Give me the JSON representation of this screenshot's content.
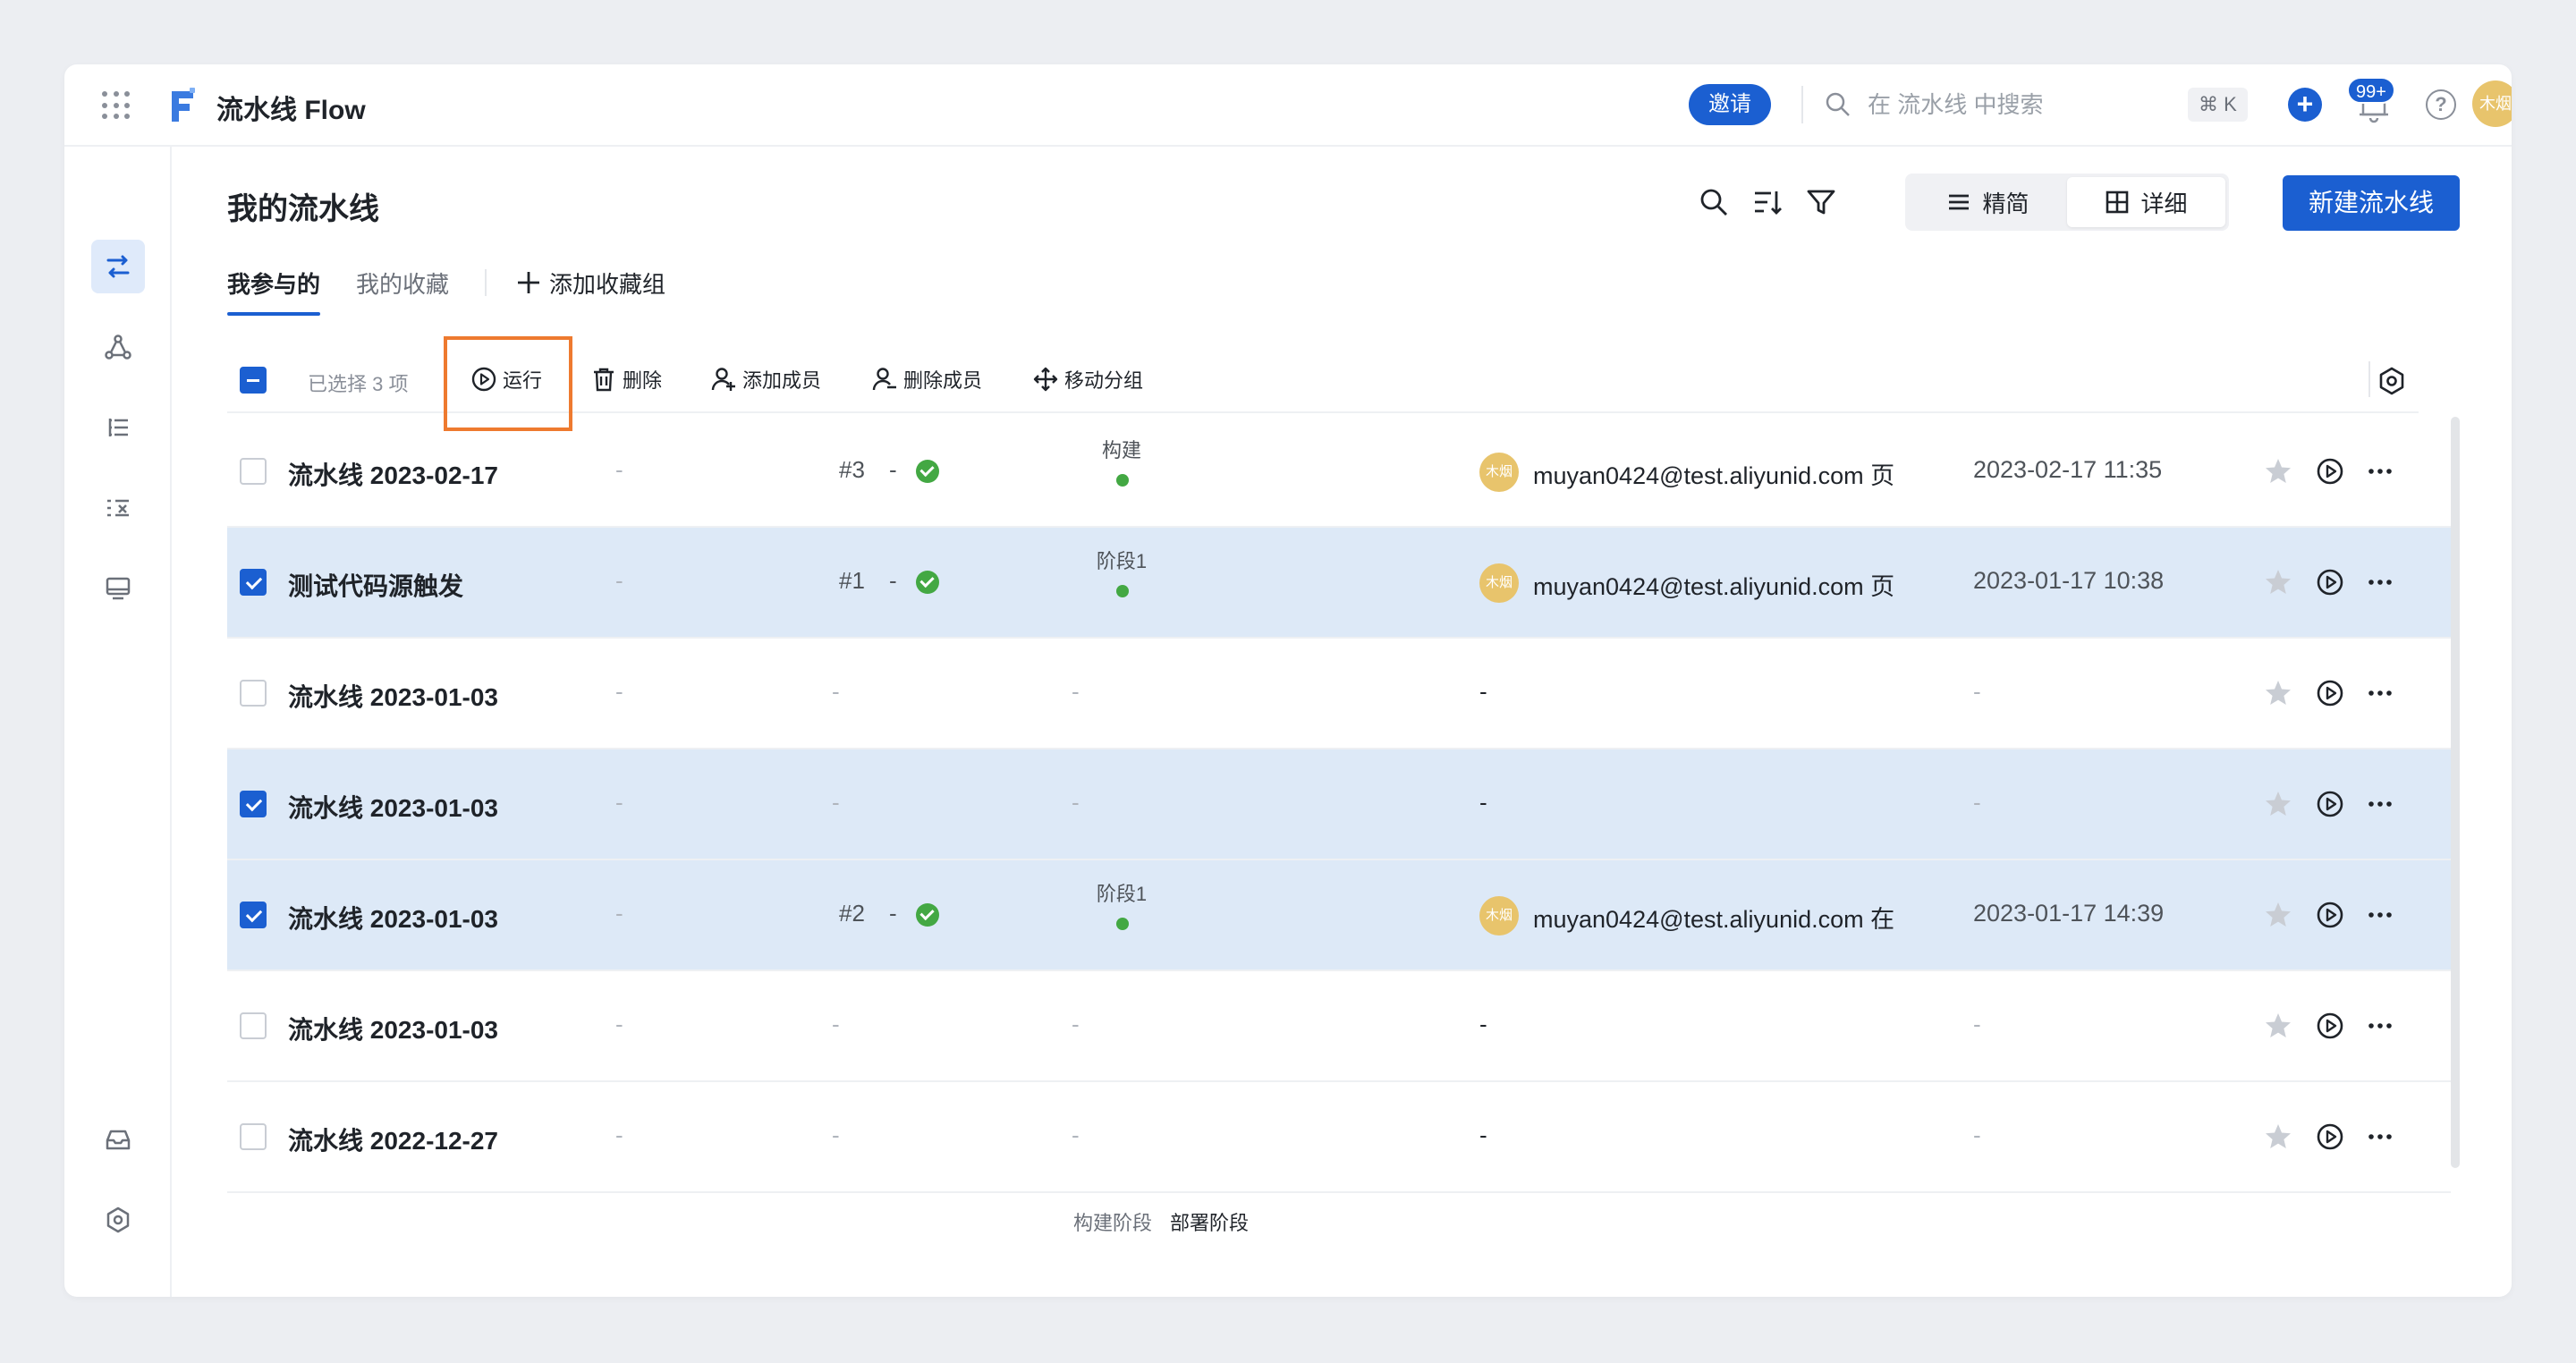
{
  "app": {
    "title": "流水线 Flow",
    "avatar": "木烟"
  },
  "header": {
    "invite_label": "邀请",
    "search_placeholder": "在 流水线 中搜索",
    "shortcut": "⌘ K",
    "notif_badge": "99+",
    "help": "?"
  },
  "page": {
    "title": "我的流水线",
    "view_simple": "精简",
    "view_detail": "详细",
    "new_label": "新建流水线"
  },
  "tabs": [
    {
      "label": "我参与的",
      "active": true
    },
    {
      "label": "我的收藏",
      "active": false
    }
  ],
  "tab_add_label": "添加收藏组",
  "actions": {
    "selected_text": "已选择 3 项",
    "run": "运行",
    "delete": "删除",
    "add_member": "添加成员",
    "remove_member": "删除成员",
    "move_group": "移动分组"
  },
  "rows": [
    {
      "name": "流水线 2023-02-17",
      "selected": false,
      "run_no": "#3",
      "status": "ok",
      "stage": "构建",
      "avatar": "木烟",
      "email": "muyan0424@test.aliyunid.com 页",
      "time": "2023-02-17 11:35"
    },
    {
      "name": "测试代码源触发",
      "selected": true,
      "run_no": "#1",
      "status": "ok",
      "stage": "阶段1",
      "avatar": "木烟",
      "email": "muyan0424@test.aliyunid.com 页",
      "time": "2023-01-17 10:38"
    },
    {
      "name": "流水线 2023-01-03",
      "selected": false,
      "run_no": "",
      "status": "",
      "stage": "",
      "avatar": "",
      "email": "",
      "time": ""
    },
    {
      "name": "流水线 2023-01-03",
      "selected": true,
      "run_no": "",
      "status": "",
      "stage": "",
      "avatar": "",
      "email": "",
      "time": ""
    },
    {
      "name": "流水线 2023-01-03",
      "selected": true,
      "run_no": "#2",
      "status": "ok",
      "stage": "阶段1",
      "avatar": "木烟",
      "email": "muyan0424@test.aliyunid.com 在",
      "time": "2023-01-17 14:39"
    },
    {
      "name": "流水线 2023-01-03",
      "selected": false,
      "run_no": "",
      "status": "",
      "stage": "",
      "avatar": "",
      "email": "",
      "time": ""
    },
    {
      "name": "流水线 2022-12-27",
      "selected": false,
      "run_no": "",
      "status": "",
      "stage": "",
      "avatar": "",
      "email": "",
      "time": ""
    }
  ],
  "footer": {
    "label_a": "构建阶段",
    "label_b": "部署阶段"
  },
  "dash": "-",
  "colors": {
    "accent": "#1b5fd1",
    "selected_row": "#dde9f7",
    "success": "#43a843",
    "highlight": "#ee7a2f"
  }
}
